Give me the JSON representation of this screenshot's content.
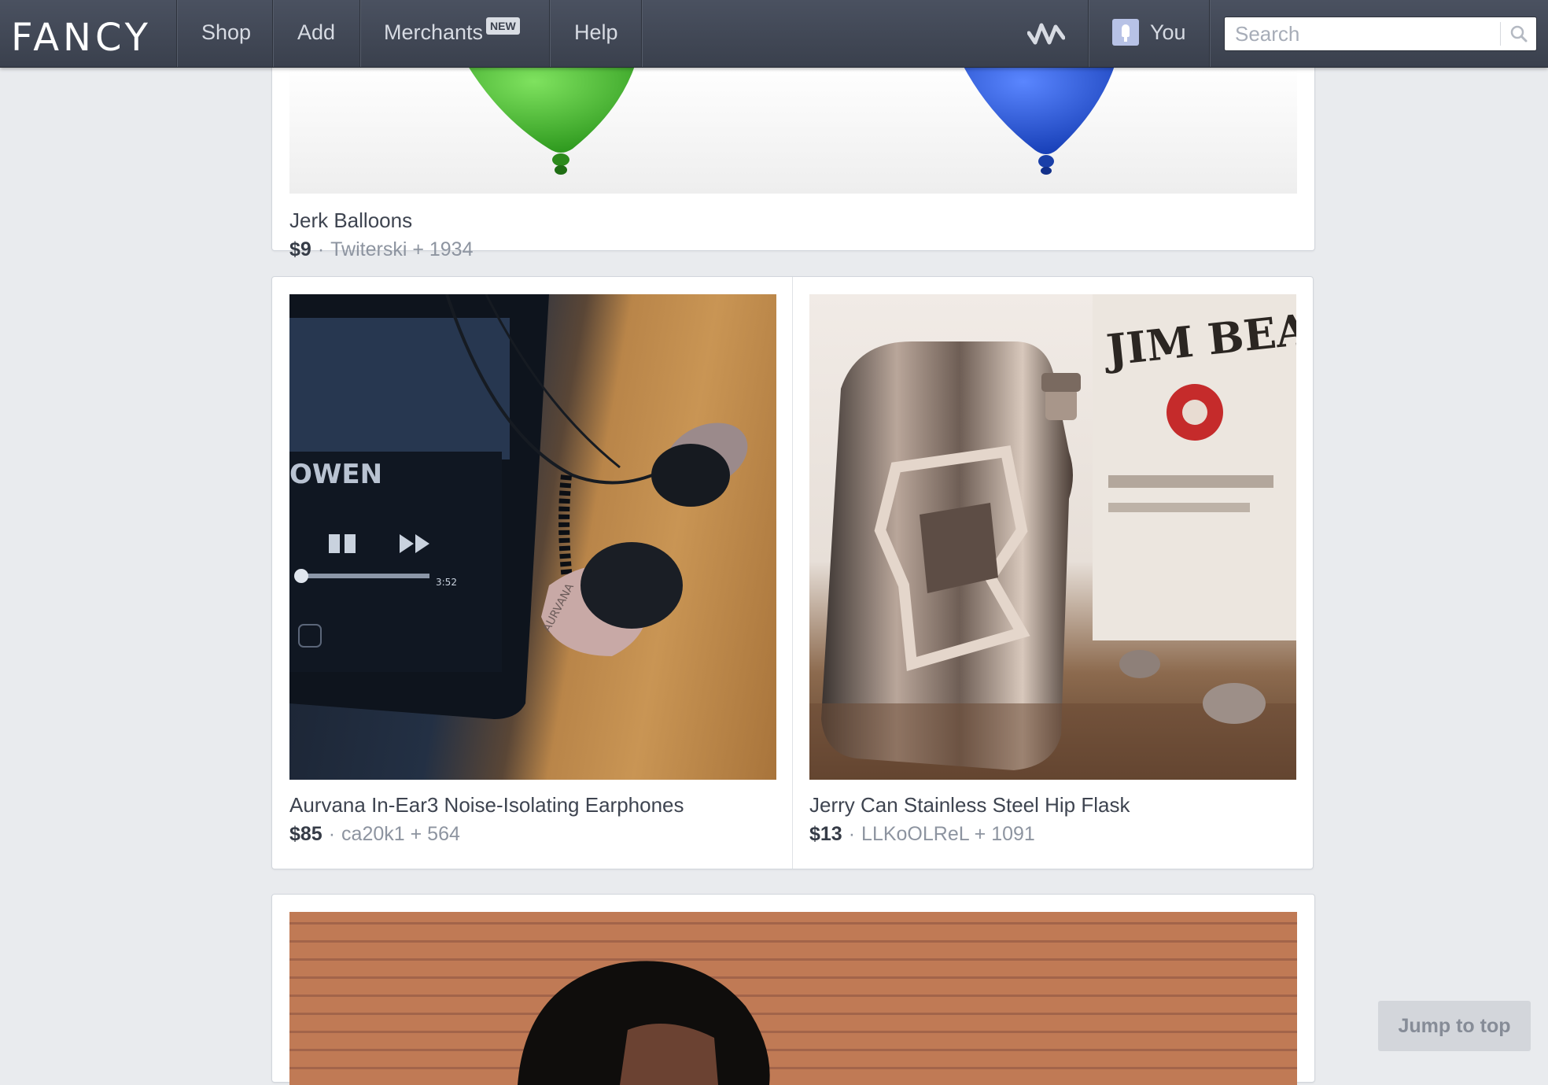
{
  "brand": {
    "logo_text": "FANCY"
  },
  "nav": {
    "shop": "Shop",
    "add": "Add",
    "merchants": "Merchants",
    "merchants_badge": "NEW",
    "help": "Help",
    "you": "You"
  },
  "search": {
    "placeholder": "Search",
    "value": ""
  },
  "feed": {
    "items": [
      {
        "title": "Jerk Balloons",
        "price": "$9",
        "user": "Twiterski",
        "count": "+ 1934"
      },
      {
        "title": "Aurvana In-Ear3 Noise-Isolating Earphones",
        "price": "$85",
        "user": "ca20k1",
        "count": "+ 564"
      },
      {
        "title": "Jerry Can Stainless Steel Hip Flask",
        "price": "$13",
        "user": "LLKoOLReL",
        "count": "+ 1091"
      }
    ],
    "separator": "·"
  },
  "image_text": {
    "ear_screen": "OWEN",
    "ear_time": "3:52",
    "ear_brand": "AURVANA",
    "flask_bottle": "JIM BEAM"
  },
  "jump_to_top": "Jump to top",
  "colors": {
    "nav_bg": "#3f4553",
    "page_bg": "#e9ebee",
    "balloon_green": "#45b630",
    "balloon_blue": "#2556d8"
  },
  "icons": [
    "activity-icon",
    "user-icon",
    "search-icon"
  ]
}
